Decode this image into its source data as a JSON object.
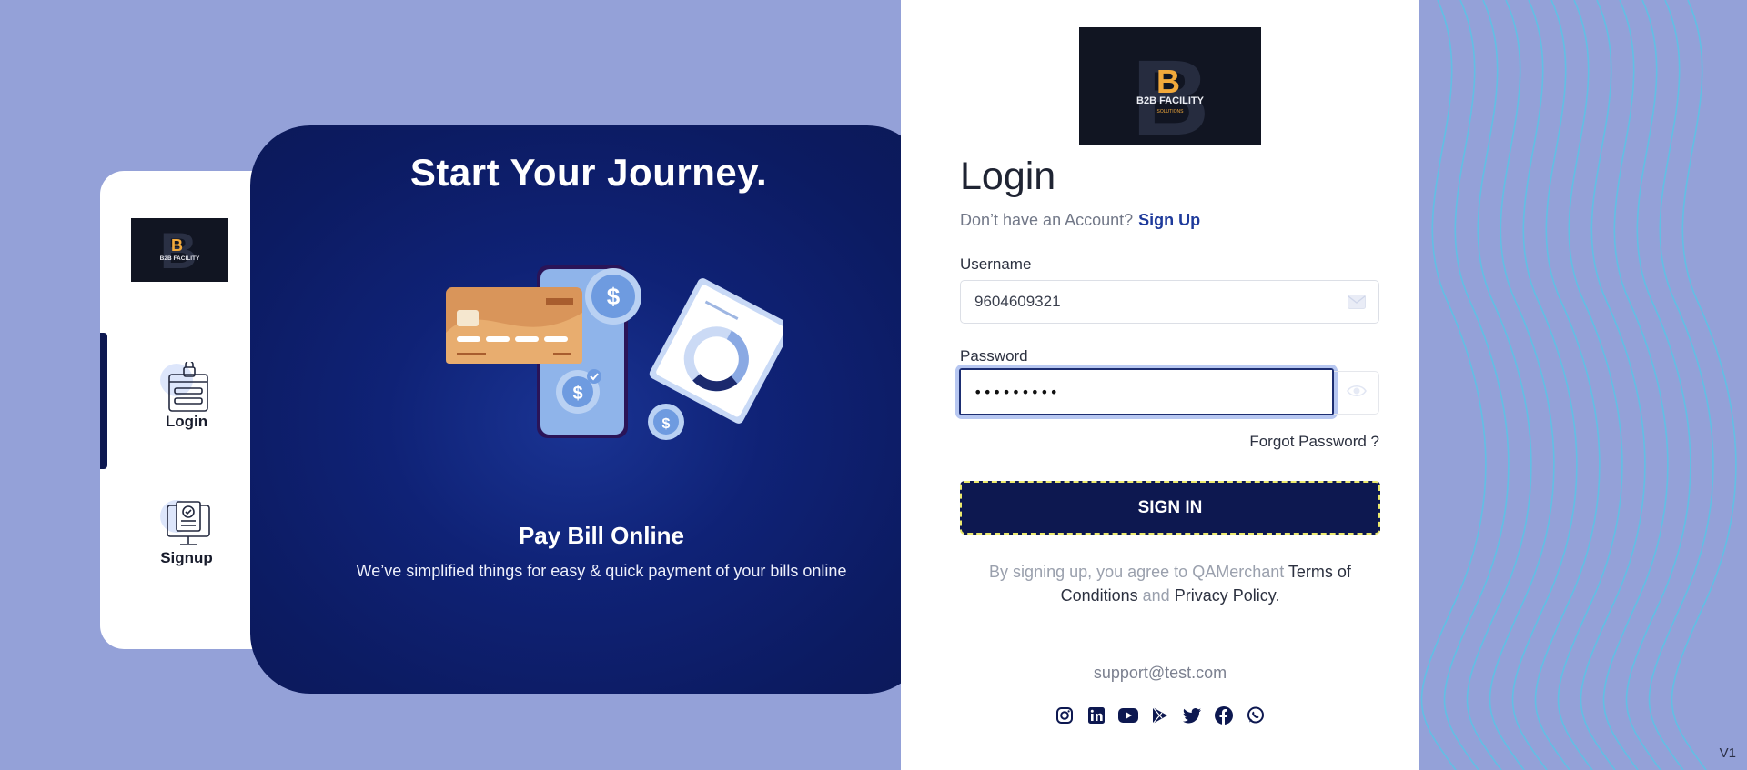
{
  "hero": {
    "title": "Start Your Journey.",
    "subtitle": "Pay Bill Online",
    "description": "We’ve simplified things for easy & quick payment of your bills online",
    "card_symbol": "$"
  },
  "sidebar": {
    "items": [
      {
        "label": "Login",
        "icon": "login-form-icon",
        "active": true
      },
      {
        "label": "Signup",
        "icon": "signup-monitor-icon",
        "active": false
      }
    ]
  },
  "logo": {
    "name": "B2B FACILITY",
    "tagline": "SOLUTIONS"
  },
  "login": {
    "title": "Login",
    "no_account_text": "Don’t have an Account?",
    "signup_link": "Sign Up",
    "username_label": "Username",
    "username_value": "9604609321",
    "password_label": "Password",
    "password_value": "abcdefghi",
    "forgot_password": "Forgot Password ?",
    "sign_in_button": "SIGN IN",
    "terms_prefix": "By signing up, you agree to QAMerchant",
    "terms_link": "Terms of Conditions",
    "terms_and": "and",
    "privacy_link": "Privacy Policy."
  },
  "support_email": "support@test.com",
  "social_icons": [
    "instagram-icon",
    "linkedin-icon",
    "youtube-icon",
    "google-play-icon",
    "twitter-icon",
    "facebook-icon",
    "whatsapp-icon"
  ],
  "version": "V1",
  "colors": {
    "background": "#94a1d8",
    "navy": "#0d1850",
    "hero_blue": "#0f2276",
    "link_blue": "#1e3a9b",
    "focus_ring": "#b7c7f1",
    "card_orange": "#d9955a"
  }
}
